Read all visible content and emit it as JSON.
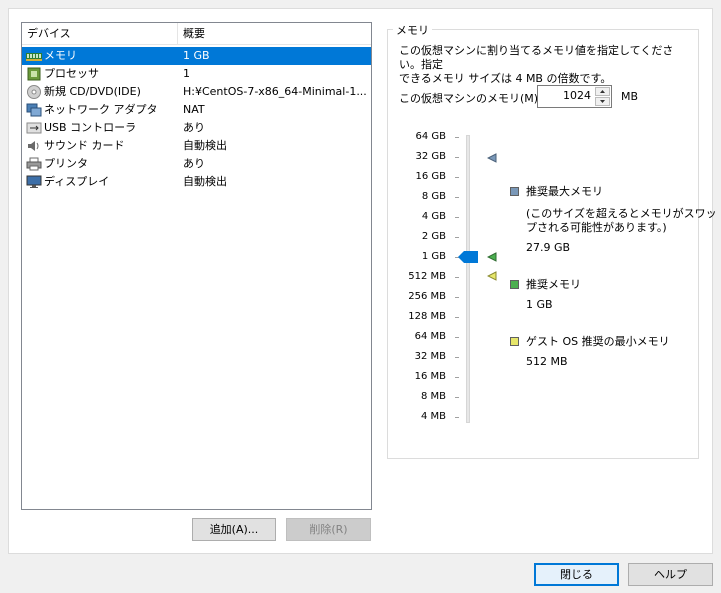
{
  "device_list": {
    "header": {
      "device": "デバイス",
      "summary": "概要"
    },
    "rows": [
      {
        "name": "メモリ",
        "value": "1 GB",
        "icon": "memory-icon",
        "selected": true
      },
      {
        "name": "プロセッサ",
        "value": "1",
        "icon": "processor-icon"
      },
      {
        "name": "新規 CD/DVD(IDE)",
        "value": "H:¥CentOS-7-x86_64-Minimal-1...",
        "icon": "cd-dvd-icon"
      },
      {
        "name": "ネットワーク アダプタ",
        "value": "NAT",
        "icon": "network-adapter-icon"
      },
      {
        "name": "USB コントローラ",
        "value": "あり",
        "icon": "usb-icon"
      },
      {
        "name": "サウンド カード",
        "value": "自動検出",
        "icon": "sound-icon"
      },
      {
        "name": "プリンタ",
        "value": "あり",
        "icon": "printer-icon"
      },
      {
        "name": "ディスプレイ",
        "value": "自動検出",
        "icon": "display-icon"
      }
    ]
  },
  "buttons": {
    "add": "追加(A)...",
    "remove": "削除(R)",
    "close": "閉じる",
    "help": "ヘルプ"
  },
  "memory": {
    "group_title": "メモリ",
    "description_line1": "この仮想マシンに割り当てるメモリ値を指定してください。指定",
    "description_line2": "できるメモリ サイズは 4 MB の倍数です。",
    "field_label": "この仮想マシンのメモリ(M):",
    "value": "1024",
    "unit": "MB",
    "scale": [
      "64 GB",
      "32 GB",
      "16 GB",
      "8 GB",
      "4 GB",
      "2 GB",
      "1 GB",
      "512 MB",
      "256 MB",
      "128 MB",
      "64 MB",
      "32 MB",
      "16 MB",
      "8 MB",
      "4 MB"
    ],
    "current_level": "1 GB",
    "legend": {
      "max_title": "推奨最大メモリ",
      "max_note_line1": "(このサイズを超えるとメモリがスワッ",
      "max_note_line2": "プされる可能性があります。)",
      "max_value": "27.9 GB",
      "rec_title": "推奨メモリ",
      "rec_value": "1 GB",
      "min_title": "ゲスト OS 推奨の最小メモリ",
      "min_value": "512 MB"
    }
  },
  "colors": {
    "selection": "#0078d7",
    "max_marker": "#7a98b8",
    "recommended_marker": "#4caf50",
    "min_marker": "#e6e66a"
  }
}
